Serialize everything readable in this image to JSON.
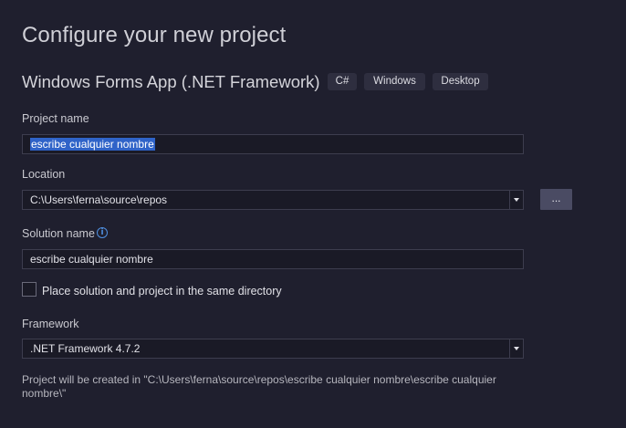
{
  "header": {
    "title": "Configure your new project",
    "template_name": "Windows Forms App (.NET Framework)",
    "tags": [
      "C#",
      "Windows",
      "Desktop"
    ]
  },
  "project_name": {
    "label": "Project name",
    "value": "escribe cualquier nombre"
  },
  "location": {
    "label": "Location",
    "value": "C:\\Users\\ferna\\source\\repos",
    "browse_label": "..."
  },
  "solution_name": {
    "label": "Solution name",
    "info_icon": "info-icon",
    "value": "escribe cualquier nombre"
  },
  "same_directory": {
    "label": "Place solution and project in the same directory",
    "checked": false
  },
  "framework": {
    "label": "Framework",
    "value": ".NET Framework 4.7.2"
  },
  "footnote": "Project will be created in \"C:\\Users\\ferna\\source\\repos\\escribe cualquier nombre\\escribe cualquier nombre\\\"",
  "colors": {
    "background": "#1f1f2e",
    "selection": "#2f63c8",
    "info_accent": "#4f8fe0"
  }
}
